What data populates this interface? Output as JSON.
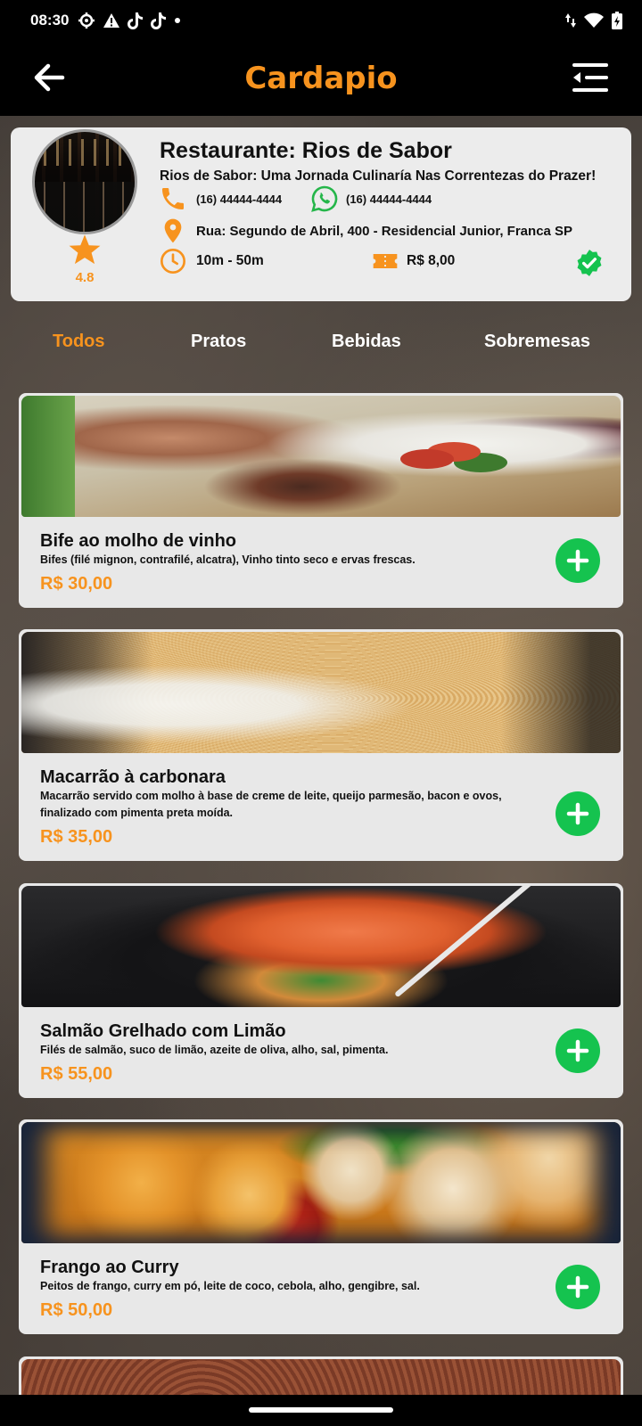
{
  "status_bar": {
    "time": "08:30",
    "icons": [
      "settings-icon",
      "alert-icon",
      "tiktok-icon",
      "tiktok-icon",
      "dot-icon"
    ],
    "right_icons": [
      "data-arrows-icon",
      "wifi-icon",
      "battery-charging-icon"
    ]
  },
  "header": {
    "title": "Cardapio",
    "back_icon": "arrow-left-icon",
    "menu_icon": "menu-collapse-icon"
  },
  "restaurant": {
    "name": "Restaurante: Rios de Sabor",
    "tagline": "Rios de Sabor: Uma Jornada Culinaría Nas Correntezas do Prazer!",
    "rating": "4.8",
    "phone": "(16) 44444-4444",
    "whatsapp": "(16) 44444-4444",
    "address": "Rua: Segundo de Abril, 400 - Residencial Junior, Franca SP",
    "delivery_time": "10m - 50m",
    "delivery_fee": "R$ 8,00",
    "verified_icon": "verified-badge-icon"
  },
  "tabs": [
    {
      "label": "Todos",
      "active": true
    },
    {
      "label": "Pratos",
      "active": false
    },
    {
      "label": "Bebidas",
      "active": false
    },
    {
      "label": "Sobremesas",
      "active": false
    }
  ],
  "dishes": [
    {
      "title": "Bife ao molho de vinho",
      "description": "Bifes (filé mignon, contrafilé, alcatra), Vinho tinto seco e ervas frescas.",
      "price": "R$ 30,00"
    },
    {
      "title": "Macarrão à carbonara",
      "description": "Macarrão servido com molho à base de creme de leite, queijo parmesão, bacon e ovos, finalizado com pimenta preta moída.",
      "price": "R$ 35,00"
    },
    {
      "title": "Salmão Grelhado com Limão",
      "description": "Filés de salmão, suco de limão, azeite de oliva, alho, sal, pimenta.",
      "price": "R$ 55,00"
    },
    {
      "title": "Frango ao Curry",
      "description": "Peitos de frango, curry em pó, leite de coco, cebola, alho, gengibre, sal.",
      "price": "R$ 50,00"
    }
  ],
  "colors": {
    "accent": "#f7931e",
    "add_button": "#15c34f",
    "whatsapp": "#25b64a",
    "card_bg": "#ececec"
  }
}
